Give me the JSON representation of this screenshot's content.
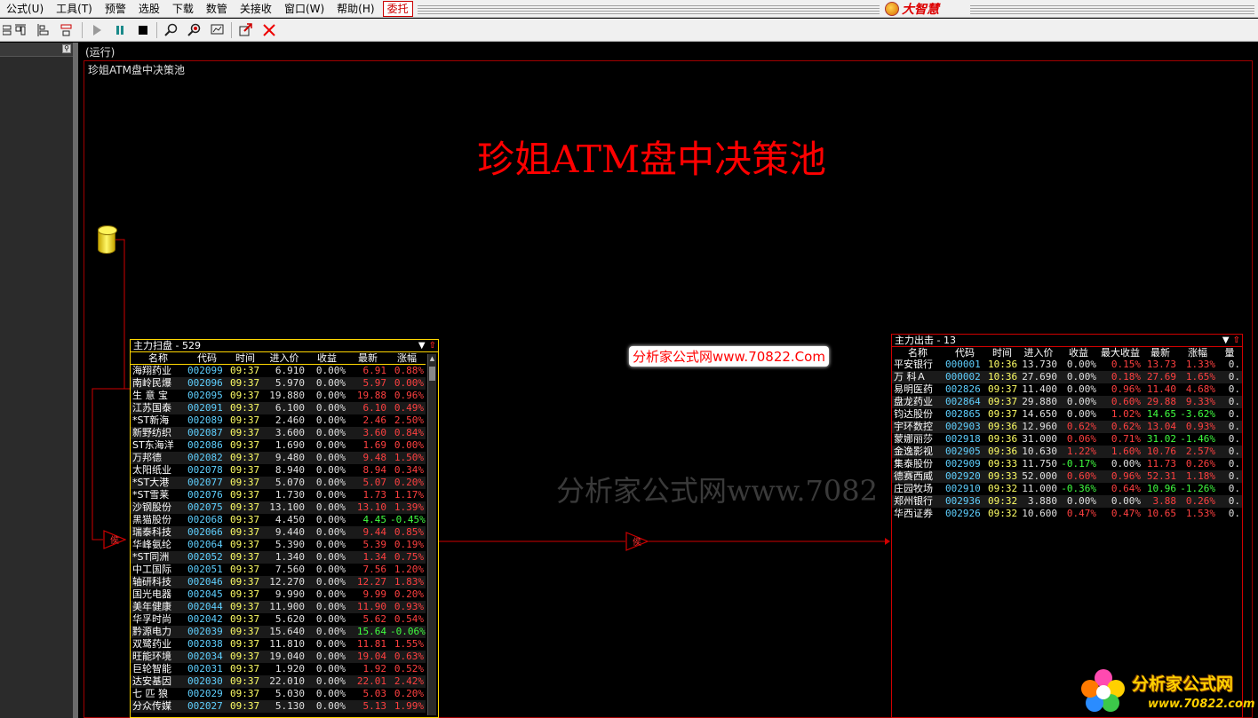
{
  "menu": [
    "公式(U)",
    "工具(T)",
    "预警",
    "选股",
    "下载",
    "数管",
    "关接收",
    "窗口(W)",
    "帮助(H)"
  ],
  "menu_special": "委托",
  "brand": "大智慧",
  "canvas": {
    "status": "(运行)",
    "name": "珍姐ATM盘中决策池",
    "title": "珍姐ATM盘中决策池",
    "watermark": "分析家公式网www.7082",
    "url_badge": "分析家公式网www.70822.Com"
  },
  "gate_label": "侯",
  "scan_panel": {
    "title": "主力扫盘",
    "count": "529",
    "headers": [
      "名称",
      "代码",
      "时间",
      "进入价",
      "收益",
      "最新",
      "涨幅"
    ],
    "rows": [
      [
        "海翔药业",
        "002099",
        "09:37",
        "6.910",
        "0.00%",
        "6.91",
        "0.88%"
      ],
      [
        "南岭民爆",
        "002096",
        "09:37",
        "5.970",
        "0.00%",
        "5.97",
        "0.00%"
      ],
      [
        "生 意 宝",
        "002095",
        "09:37",
        "19.880",
        "0.00%",
        "19.88",
        "0.96%"
      ],
      [
        "江苏国泰",
        "002091",
        "09:37",
        "6.100",
        "0.00%",
        "6.10",
        "0.49%"
      ],
      [
        "*ST新海",
        "002089",
        "09:37",
        "2.460",
        "0.00%",
        "2.46",
        "2.50%"
      ],
      [
        "新野纺织",
        "002087",
        "09:37",
        "3.600",
        "0.00%",
        "3.60",
        "0.84%"
      ],
      [
        "ST东海洋",
        "002086",
        "09:37",
        "1.690",
        "0.00%",
        "1.69",
        "0.00%"
      ],
      [
        "万邦德",
        "002082",
        "09:37",
        "9.480",
        "0.00%",
        "9.48",
        "1.50%"
      ],
      [
        "太阳纸业",
        "002078",
        "09:37",
        "8.940",
        "0.00%",
        "8.94",
        "0.34%"
      ],
      [
        "*ST大港",
        "002077",
        "09:37",
        "5.070",
        "0.00%",
        "5.07",
        "0.20%"
      ],
      [
        "*ST雪莱",
        "002076",
        "09:37",
        "1.730",
        "0.00%",
        "1.73",
        "1.17%"
      ],
      [
        "沙钢股份",
        "002075",
        "09:37",
        "13.100",
        "0.00%",
        "13.10",
        "1.39%"
      ],
      [
        "黑猫股份",
        "002068",
        "09:37",
        "4.450",
        "0.00%",
        "4.45",
        "-0.45%"
      ],
      [
        "瑞泰科技",
        "002066",
        "09:37",
        "9.440",
        "0.00%",
        "9.44",
        "0.85%"
      ],
      [
        "华峰氨纶",
        "002064",
        "09:37",
        "5.390",
        "0.00%",
        "5.39",
        "0.19%"
      ],
      [
        "*ST同洲",
        "002052",
        "09:37",
        "1.340",
        "0.00%",
        "1.34",
        "0.75%"
      ],
      [
        "中工国际",
        "002051",
        "09:37",
        "7.560",
        "0.00%",
        "7.56",
        "1.20%"
      ],
      [
        "轴研科技",
        "002046",
        "09:37",
        "12.270",
        "0.00%",
        "12.27",
        "1.83%"
      ],
      [
        "国光电器",
        "002045",
        "09:37",
        "9.990",
        "0.00%",
        "9.99",
        "0.20%"
      ],
      [
        "美年健康",
        "002044",
        "09:37",
        "11.900",
        "0.00%",
        "11.90",
        "0.93%"
      ],
      [
        "华孚时尚",
        "002042",
        "09:37",
        "5.620",
        "0.00%",
        "5.62",
        "0.54%"
      ],
      [
        "黔源电力",
        "002039",
        "09:37",
        "15.640",
        "0.00%",
        "15.64",
        "-0.06%"
      ],
      [
        "双鹭药业",
        "002038",
        "09:37",
        "11.810",
        "0.00%",
        "11.81",
        "1.55%"
      ],
      [
        "旺能环境",
        "002034",
        "09:37",
        "19.040",
        "0.00%",
        "19.04",
        "0.63%"
      ],
      [
        "巨轮智能",
        "002031",
        "09:37",
        "1.920",
        "0.00%",
        "1.92",
        "0.52%"
      ],
      [
        "达安基因",
        "002030",
        "09:37",
        "22.010",
        "0.00%",
        "22.01",
        "2.42%"
      ],
      [
        "七 匹 狼",
        "002029",
        "09:37",
        "5.030",
        "0.00%",
        "5.03",
        "0.20%"
      ],
      [
        "分众传媒",
        "002027",
        "09:37",
        "5.130",
        "0.00%",
        "5.13",
        "1.99%"
      ]
    ]
  },
  "exit_panel": {
    "title": "主力出击",
    "count": "13",
    "headers": [
      "名称",
      "代码",
      "时间",
      "进入价",
      "收益",
      "最大收益",
      "最新",
      "涨幅",
      "量"
    ],
    "rows": [
      [
        "平安银行",
        "000001",
        "10:36",
        "13.730",
        "0.00%",
        "0.15%",
        "13.73",
        "1.33%",
        "0."
      ],
      [
        "万 科Ａ",
        "000002",
        "10:36",
        "27.690",
        "0.00%",
        "0.18%",
        "27.69",
        "1.65%",
        "0."
      ],
      [
        "易明医药",
        "002826",
        "09:37",
        "11.400",
        "0.00%",
        "0.96%",
        "11.40",
        "4.68%",
        "0."
      ],
      [
        "盘龙药业",
        "002864",
        "09:37",
        "29.880",
        "0.00%",
        "0.60%",
        "29.88",
        "9.33%",
        "0."
      ],
      [
        "钧达股份",
        "002865",
        "09:37",
        "14.650",
        "0.00%",
        "1.02%",
        "14.65",
        "-3.62%",
        "0."
      ],
      [
        "宇环数控",
        "002903",
        "09:36",
        "12.960",
        "0.62%",
        "0.62%",
        "13.04",
        "0.93%",
        "0."
      ],
      [
        "蒙娜丽莎",
        "002918",
        "09:36",
        "31.000",
        "0.06%",
        "0.71%",
        "31.02",
        "-1.46%",
        "0."
      ],
      [
        "金逸影视",
        "002905",
        "09:36",
        "10.630",
        "1.22%",
        "1.60%",
        "10.76",
        "2.57%",
        "0."
      ],
      [
        "集泰股份",
        "002909",
        "09:33",
        "11.750",
        "-0.17%",
        "0.00%",
        "11.73",
        "0.26%",
        "0."
      ],
      [
        "德赛西威",
        "002920",
        "09:33",
        "52.000",
        "0.60%",
        "0.96%",
        "52.31",
        "1.18%",
        "0."
      ],
      [
        "庄园牧场",
        "002910",
        "09:32",
        "11.000",
        "-0.36%",
        "0.64%",
        "10.96",
        "-1.26%",
        "0."
      ],
      [
        "郑州银行",
        "002936",
        "09:32",
        "3.880",
        "0.00%",
        "0.00%",
        "3.88",
        "0.26%",
        "0."
      ],
      [
        "华西证券",
        "002926",
        "09:32",
        "10.600",
        "0.47%",
        "0.47%",
        "10.65",
        "1.53%",
        "0."
      ]
    ]
  },
  "logo": {
    "text": "分析家公式网",
    "url": "www.70822.com"
  }
}
